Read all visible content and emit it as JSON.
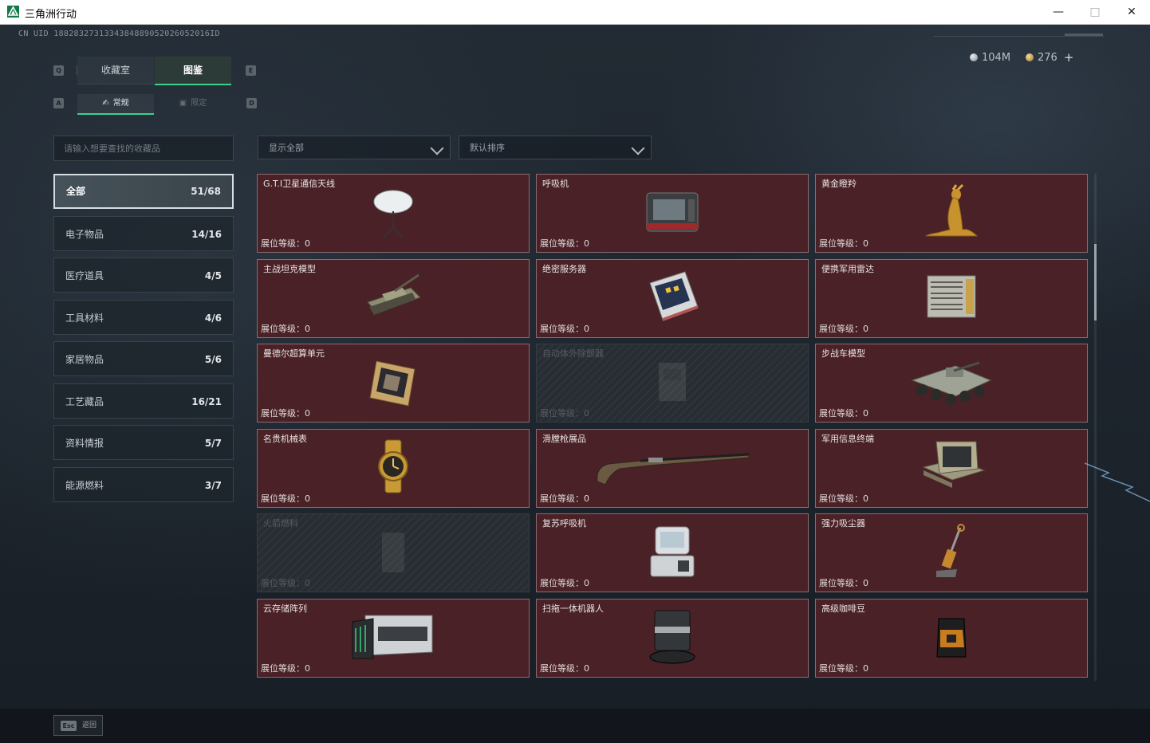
{
  "window": {
    "title": "三角洲行动"
  },
  "header": {
    "uid": "CN UID 1882832731334384889052026052016ID",
    "currency_silver": "104M",
    "currency_gold": "276",
    "add_symbol": "+"
  },
  "key_hints": {
    "tab_left": "Q",
    "tab_right": "E",
    "sub_left": "A",
    "sub_right": "D"
  },
  "tabs": {
    "collection": "收藏室",
    "atlas": "图鉴"
  },
  "subtabs": {
    "regular": "常规",
    "limited": "限定"
  },
  "search": {
    "placeholder": "请输入想要查找的收藏品"
  },
  "filters": {
    "show": "显示全部",
    "sort": "默认排序"
  },
  "categories": [
    {
      "name": "全部",
      "count": "51/68"
    },
    {
      "name": "电子物品",
      "count": "14/16"
    },
    {
      "name": "医疗道具",
      "count": "4/5"
    },
    {
      "name": "工具材料",
      "count": "4/6"
    },
    {
      "name": "家居物品",
      "count": "5/6"
    },
    {
      "name": "工艺藏品",
      "count": "16/21"
    },
    {
      "name": "资料情报",
      "count": "5/7"
    },
    {
      "name": "能源燃料",
      "count": "3/7"
    }
  ],
  "items": [
    {
      "name": "G.T.I卫星通信天线",
      "level": "展位等级：0",
      "icon": "satellite-dish-icon"
    },
    {
      "name": "呼吸机",
      "level": "展位等级：0",
      "icon": "ventilator-icon"
    },
    {
      "name": "黄金瞪羚",
      "level": "展位等级：0",
      "icon": "golden-gazelle-icon"
    },
    {
      "name": "主战坦克模型",
      "level": "展位等级：0",
      "icon": "tank-model-icon"
    },
    {
      "name": "绝密服务器",
      "level": "展位等级：0",
      "icon": "server-icon"
    },
    {
      "name": "便携军用雷达",
      "level": "展位等级：0",
      "icon": "radar-icon"
    },
    {
      "name": "曼德尔超算单元",
      "level": "展位等级：0",
      "icon": "compute-unit-icon"
    },
    {
      "name": "自动体外除颤器",
      "level": "展位等级：0",
      "icon": "defibrillator-icon"
    },
    {
      "name": "步战车模型",
      "level": "展位等级：0",
      "icon": "ifv-model-icon"
    },
    {
      "name": "名贵机械表",
      "level": "展位等级：0",
      "icon": "watch-icon"
    },
    {
      "name": "滑膛枪展品",
      "level": "展位等级：0",
      "icon": "musket-icon"
    },
    {
      "name": "军用信息终端",
      "level": "展位等级：0",
      "icon": "terminal-icon"
    },
    {
      "name": "火箭燃料",
      "level": "展位等级：0",
      "icon": "rocket-fuel-icon"
    },
    {
      "name": "复苏呼吸机",
      "level": "展位等级：0",
      "icon": "resuscitator-icon"
    },
    {
      "name": "强力吸尘器",
      "level": "展位等级：0",
      "icon": "vacuum-icon"
    },
    {
      "name": "云存储阵列",
      "level": "展位等级：0",
      "icon": "storage-array-icon"
    },
    {
      "name": "扫拖一体机器人",
      "level": "展位等级：0",
      "icon": "robot-vacuum-icon"
    },
    {
      "name": "高级咖啡豆",
      "level": "展位等级：0",
      "icon": "coffee-bag-icon"
    }
  ],
  "footer": {
    "esc_key": "Esc",
    "back": "返回"
  },
  "colors": {
    "accent": "#3fd08a",
    "card_bg": "#4a2126",
    "card_border": "#8b6b70"
  }
}
